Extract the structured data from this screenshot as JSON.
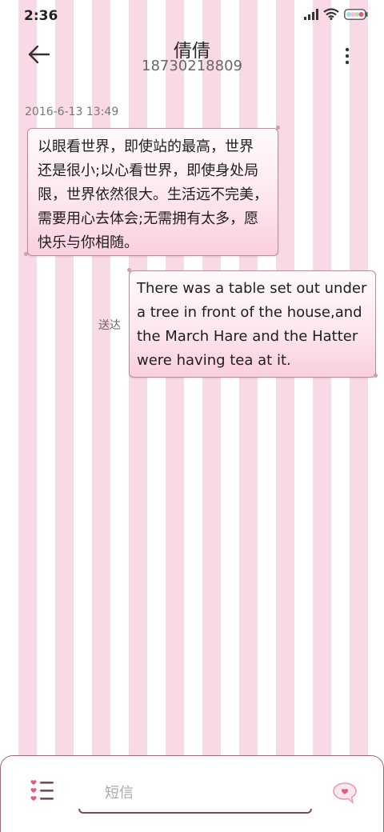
{
  "status_bar": {
    "time": "2:36",
    "icons": [
      "signal-icon",
      "wifi-icon",
      "battery-icon"
    ]
  },
  "header": {
    "contact_name": "倩倩",
    "contact_number": "18730218809",
    "back_icon": "back-arrow-icon",
    "menu_icon": "more-vertical-icon"
  },
  "conversation": {
    "timestamp": "2016-6-13 13:49",
    "received": {
      "lines": [
        "以眼看世界，即使站的最高，世界",
        "还是很小;以心看世界，即使身处局",
        "限，世界依然很大。生活远不完美，",
        "需要用心去体会;无需拥有太多，愿",
        "快乐与你相随。"
      ]
    },
    "sent": {
      "status": "送达",
      "lines": [
        "There was a table set out under",
        "a tree in front of the house,and",
        "the March Hare and the Hatter",
        "were having tea at it."
      ]
    }
  },
  "composer": {
    "placeholder": "短信",
    "value": "",
    "list_icon": "heart-list-icon",
    "send_icon": "heart-bubble-send-icon"
  },
  "colors": {
    "stripe_pink": "#fad9e7",
    "bubble_border": "#b58f99",
    "accent_rose": "#e25a7e",
    "panel_border": "#9a6b76"
  }
}
